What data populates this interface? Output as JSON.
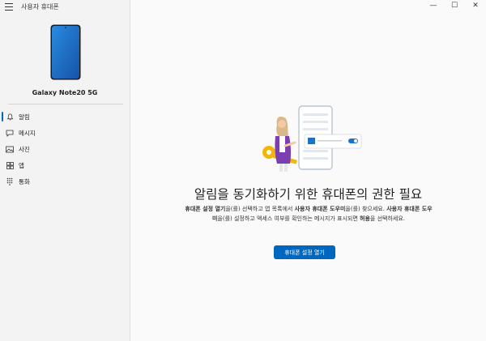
{
  "app": {
    "title": "사용자 휴대폰"
  },
  "window_controls": {
    "minimize": "—",
    "maximize": "☐",
    "close": "✕"
  },
  "phone": {
    "name": "Galaxy Note20 5G"
  },
  "nav": {
    "items": [
      {
        "label": "알림",
        "icon": "bell-icon",
        "active": true
      },
      {
        "label": "메시지",
        "icon": "chat-icon",
        "active": false
      },
      {
        "label": "사진",
        "icon": "photo-icon",
        "active": false
      },
      {
        "label": "앱",
        "icon": "apps-grid-icon",
        "active": false
      },
      {
        "label": "통화",
        "icon": "dialpad-icon",
        "active": false
      }
    ]
  },
  "main": {
    "heading": "알림을 동기화하기 위한 휴대폰의 권한 필요",
    "desc": {
      "p1": "휴대폰 설정 열기",
      "p2": "을(를) 선택하고 앱 목록에서 ",
      "p3": "사용자 휴대폰 도우미",
      "p4": "을(를) 찾으세요. ",
      "p5": "사용자 휴대폰 도우미",
      "p6": "을(를) 설정하고 액세스 여부를 확인하는 메시지가 표시되면 ",
      "p7": "허용",
      "p8": "을 선택하세요."
    },
    "button": "휴대폰 설정 열기"
  },
  "colors": {
    "accent": "#0067c0",
    "phone_screen": "#1a73c8",
    "illustration_gold": "#f2b705",
    "illustration_purple": "#7b3fb2"
  }
}
